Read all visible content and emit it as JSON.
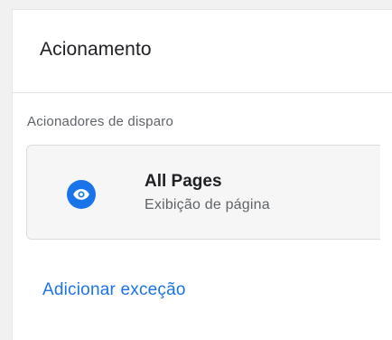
{
  "panel": {
    "title": "Acionamento"
  },
  "triggers": {
    "section_label": "Acionadores de disparo",
    "items": [
      {
        "name": "All Pages",
        "type": "Exibição de página",
        "icon": "eye-icon",
        "icon_color": "#1a73e8"
      }
    ]
  },
  "actions": {
    "add_exception_label": "Adicionar exceção",
    "link_color": "#1a73e8"
  }
}
